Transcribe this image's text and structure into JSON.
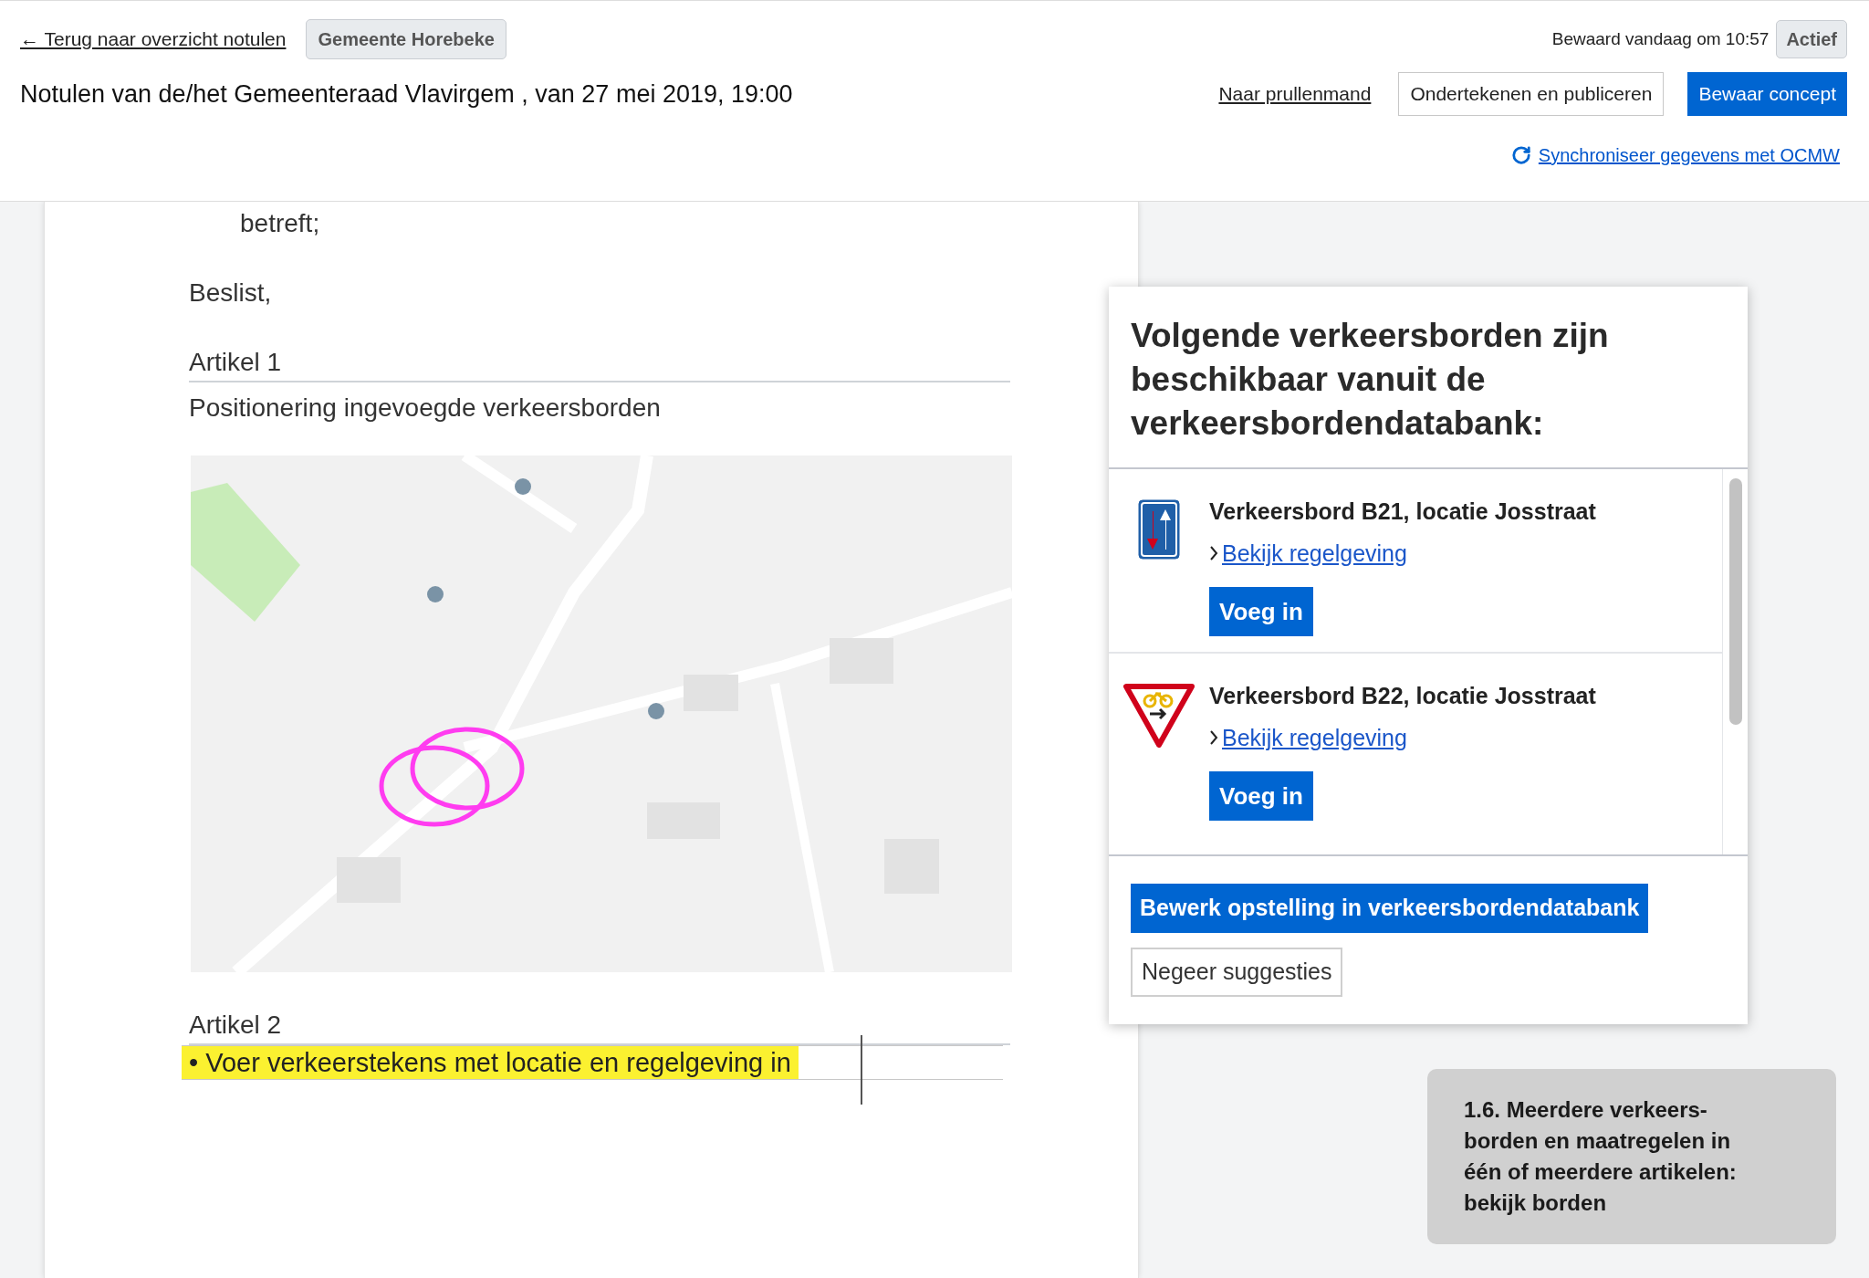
{
  "header": {
    "back_link": "← Terug naar overzicht notulen",
    "organization_badge": "Gemeente Horebeke",
    "title": "Notulen van de/het Gemeenteraad Vlavirgem , van 27 mei 2019, 19:00",
    "save_status": "Bewaard vandaag om 10:57",
    "status_badge": "Actief",
    "actions": [
      {
        "label": "Naar prullenmand",
        "kind": "link"
      },
      {
        "label": "Ondertekenen en publiceren",
        "kind": "secondary"
      },
      {
        "label": "Bewaar concept",
        "kind": "primary"
      }
    ],
    "sync_link": "Synchroniseer gegevens met OCMW"
  },
  "document": {
    "blocks": [
      {
        "kind": "indented",
        "text": "betreft;"
      },
      {
        "kind": "paragraph",
        "text": "Beslist,"
      },
      {
        "kind": "article_heading",
        "text": "Artikel 1"
      },
      {
        "kind": "article_title",
        "text": "Positionering ingevoegde verkeersborden"
      },
      {
        "kind": "picture"
      },
      {
        "kind": "article_heading",
        "text": "Artikel 2"
      },
      {
        "kind": "highlighted_bullet",
        "bullet": "•",
        "text": "Voer verkeerstekens met locatie en regelgeving in"
      }
    ]
  },
  "suggestions_panel": {
    "title": "Volgende verkeersborden zijn beschikbaar vanuit de verkeersbordendatabank:",
    "signs": [
      {
        "kind": "two-way",
        "title": "Verkeersbord B21, locatie Josstraat",
        "link": "Bekijk regelgeving",
        "button": "Voeg in"
      },
      {
        "kind": "cyclist-yield",
        "title": "Verkeersbord B22, locatie Josstraat",
        "link": "Bekijk regelgeving",
        "button": "Voeg in"
      }
    ],
    "primary_button": "Bewerk opstelling in verkeersbordendatabank",
    "secondary_button": "Negeer suggesties"
  },
  "help_note": {
    "lines": [
      "1.6. Meerdere verkeers-",
      "borden en maatregelen in",
      "één of meerdere artikelen:",
      "bekijk borden"
    ]
  }
}
